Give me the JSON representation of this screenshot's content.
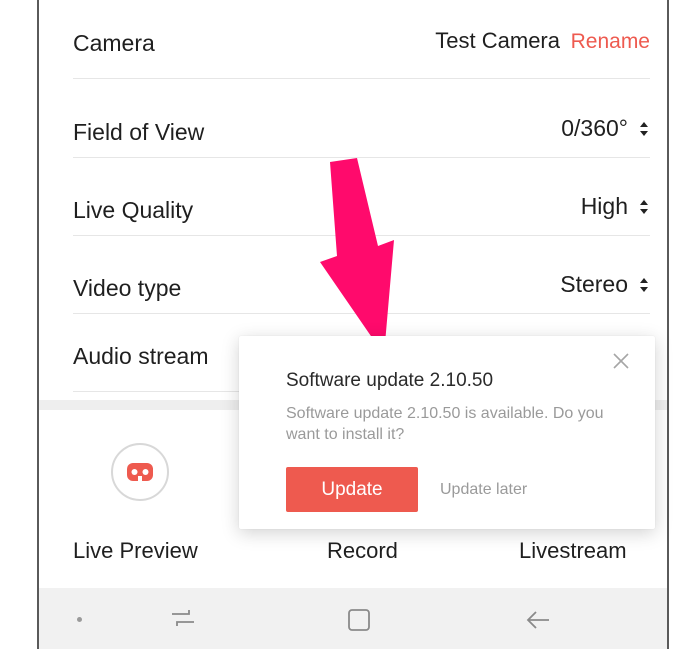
{
  "settings": {
    "camera": {
      "label": "Camera",
      "value": "Test Camera",
      "action": "Rename"
    },
    "field_of_view": {
      "label": "Field of View",
      "value": "0/360°"
    },
    "live_quality": {
      "label": "Live Quality",
      "value": "High"
    },
    "video_type": {
      "label": "Video type",
      "value": "Stereo"
    },
    "audio_stream": {
      "label": "Audio stream"
    }
  },
  "actions": {
    "live_preview": "Live Preview",
    "record": "Record",
    "livestream": "Livestream"
  },
  "dialog": {
    "title": "Software update 2.10.50",
    "message": "Software update 2.10.50 is available. Do you want to install it?",
    "update_label": "Update",
    "later_label": "Update later"
  },
  "icons": {
    "close": "close-icon",
    "updown": "updown-icon",
    "vr": "vr-headset-icon",
    "recent": "recent-apps-icon",
    "home": "home-icon",
    "back": "back-icon"
  },
  "colors": {
    "accent": "#ee5a4f",
    "annotation_arrow": "#ff0a6c"
  }
}
